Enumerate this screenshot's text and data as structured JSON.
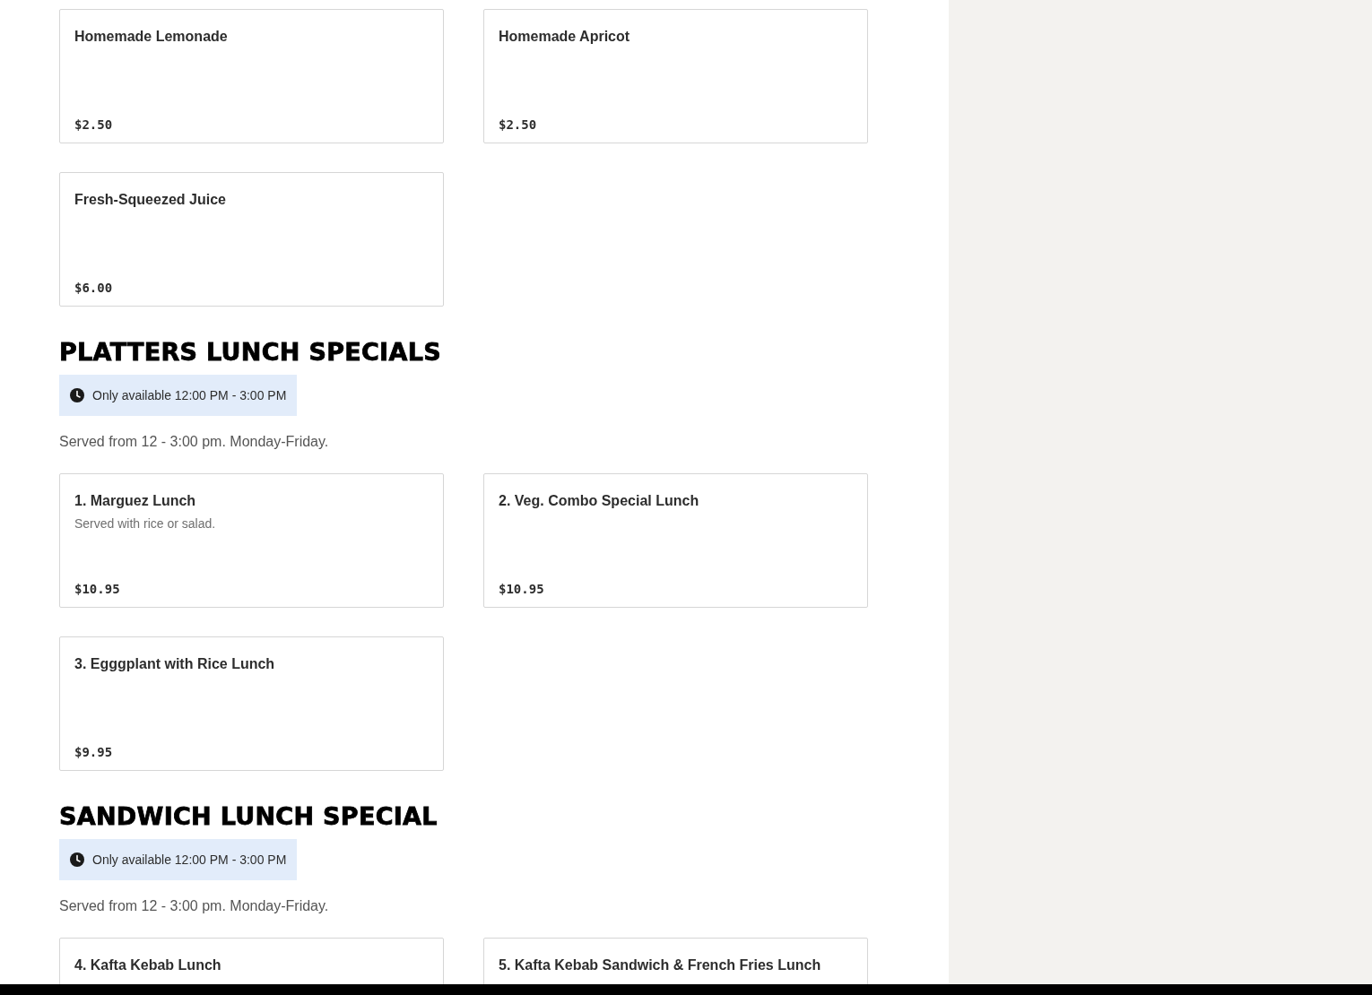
{
  "sections": [
    {
      "items": [
        {
          "name": "Homemade Lemonade",
          "price": "$2.50"
        },
        {
          "name": "Homemade Apricot",
          "price": "$2.50"
        },
        {
          "name": "Fresh-Squeezed Juice",
          "price": "$6.00"
        }
      ]
    },
    {
      "heading": "PLATTERS LUNCH SPECIALS",
      "availability": "Only available 12:00 PM - 3:00 PM",
      "description": "Served from 12 - 3:00 pm. Monday-Friday.",
      "items": [
        {
          "name": "1. Marguez Lunch",
          "description": "Served with rice or salad.",
          "price": "$10.95"
        },
        {
          "name": "2. Veg. Combo Special Lunch",
          "price": "$10.95"
        },
        {
          "name": "3. Egggplant with Rice Lunch",
          "price": "$9.95"
        }
      ]
    },
    {
      "heading": "SANDWICH LUNCH SPECIAL",
      "availability": "Only available 12:00 PM - 3:00 PM",
      "description": "Served from 12 - 3:00 pm. Monday-Friday.",
      "items": [
        {
          "name": "4. Kafta Kebab Lunch"
        },
        {
          "name": "5. Kafta Kebab Sandwich & French Fries Lunch"
        }
      ]
    }
  ]
}
